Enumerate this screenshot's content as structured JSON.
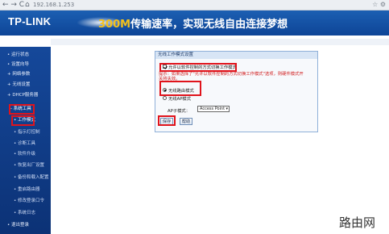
{
  "browser": {
    "nav_arrows": "← → C",
    "home_icon": "home-icon",
    "address": "192.168.1.253",
    "right_icons": "☆ ⚙"
  },
  "header": {
    "logo": "TP-LINK",
    "slogan_highlight": "300M",
    "slogan_rest": "传输速率，实现无线自由连接梦想"
  },
  "sidebar": {
    "items": [
      {
        "label": "• 运行状态"
      },
      {
        "label": "• 设置向导"
      },
      {
        "label": "+ 网络参数"
      },
      {
        "label": "+ 无线设置"
      },
      {
        "label": "+ DHCP服务器"
      },
      {
        "label": "- 系统工具"
      },
      {
        "label": "• 工作模式"
      },
      {
        "label": "• 指示灯控制"
      },
      {
        "label": "• 诊断工具"
      },
      {
        "label": "• 软件升级"
      },
      {
        "label": "• 恢复出厂设置"
      },
      {
        "label": "• 备份和载入配置"
      },
      {
        "label": "• 重启路由器"
      },
      {
        "label": "• 修改登录口令"
      },
      {
        "label": "• 系统日志"
      },
      {
        "label": "• 退出登录"
      }
    ]
  },
  "panel": {
    "title": "无线工作模式设置",
    "checkbox_label": "允许以软件控制的方式切换工作模式",
    "checkbox_checked": true,
    "hint": "提示：如果选择了\"允许以软件控制的方式切换工作模式\"选项，则硬件模式开关将失效。",
    "mode_router": "无线路由模式",
    "mode_ap": "无线AP模式",
    "ap_submode_label": "AP子模式：",
    "ap_submode_value": "Access Point",
    "save": "保存",
    "help": "帮助"
  },
  "watermark": "路由网",
  "colors": {
    "brand_blue": "#0e4597",
    "highlight_red": "#e0141c",
    "hint_red": "#d01818",
    "slogan_gold": "#f5c21b"
  }
}
